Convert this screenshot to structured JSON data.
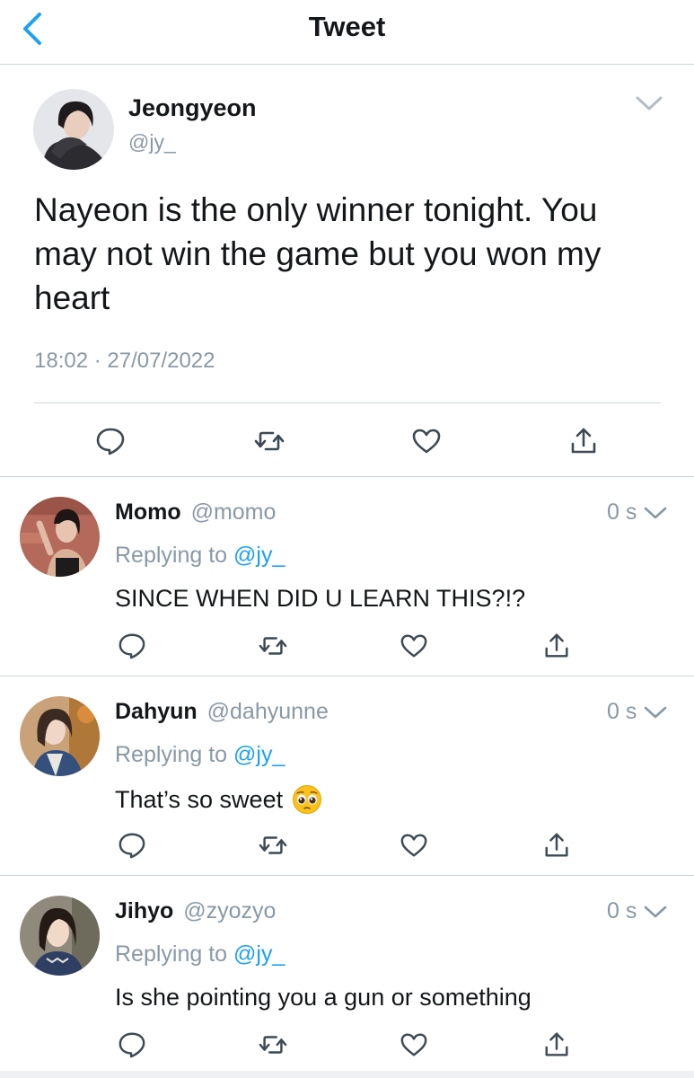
{
  "header": {
    "title": "Tweet",
    "back_icon": "chevron-left-icon"
  },
  "main_tweet": {
    "author_name": "Jeongyeon",
    "author_handle": "@jy_",
    "text": "Nayeon is the only winner tonight. You may not win the game but you won my heart",
    "timestamp": "18:02 · 27/07/2022",
    "actions": [
      "reply-icon",
      "retweet-icon",
      "like-icon",
      "share-icon"
    ]
  },
  "replies": [
    {
      "name": "Momo",
      "handle": "@momo",
      "time": "0 s",
      "replying_prefix": "Replying to ",
      "replying_to": "@jy_",
      "text": "SINCE WHEN DID U LEARN THIS?!?",
      "emoji": ""
    },
    {
      "name": "Dahyun",
      "handle": "@dahyunne",
      "time": "0 s",
      "replying_prefix": "Replying to ",
      "replying_to": "@jy_",
      "text": "That’s so sweet",
      "emoji": "pleading-face-emoji"
    },
    {
      "name": "Jihyo",
      "handle": "@zyozyo",
      "time": "0 s",
      "replying_prefix": "Replying to ",
      "replying_to": "@jy_",
      "text": "Is she pointing you a gun or something",
      "emoji": ""
    }
  ],
  "colors": {
    "accent": "#1da1f2",
    "text_primary": "#14171a",
    "text_secondary": "#8899a6",
    "divider": "#cfd5da"
  }
}
